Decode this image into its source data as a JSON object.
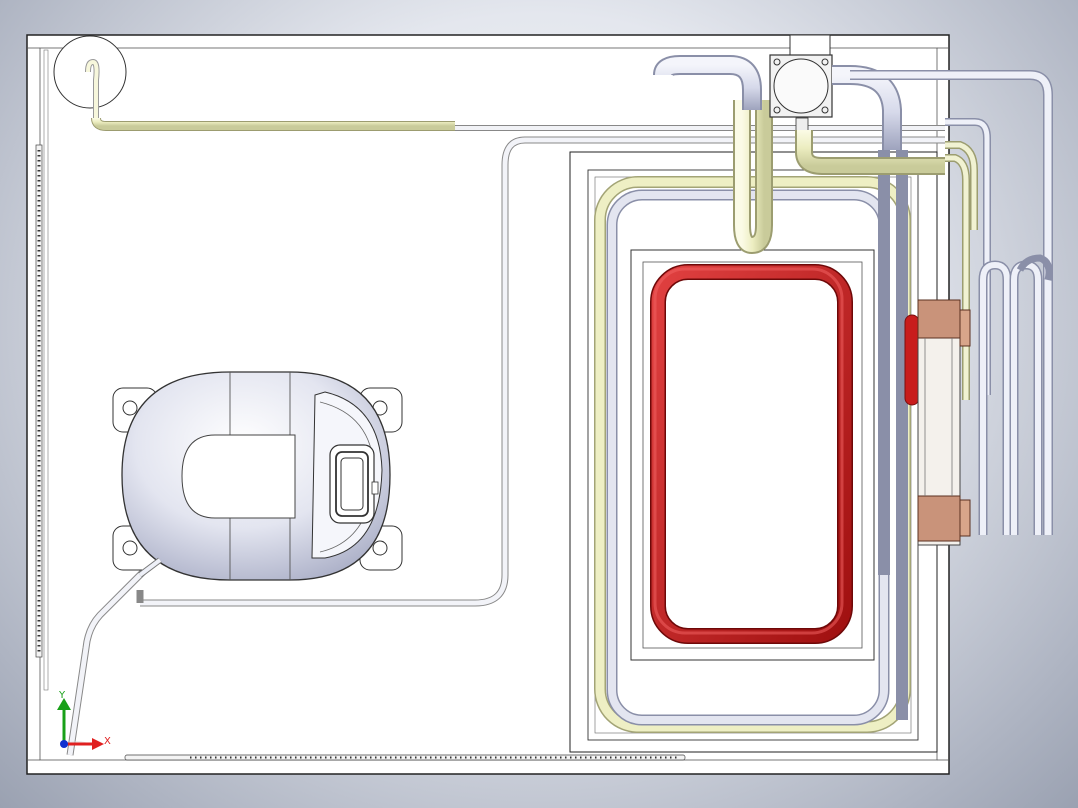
{
  "viewport": {
    "background": "#cfd3dc",
    "triad": {
      "x_label": "X",
      "y_label": "Y",
      "x_color": "#e02020",
      "y_color": "#18a018",
      "origin_color": "#1030d0"
    }
  },
  "model": {
    "panel_color": "#ffffff",
    "edge_color": "#2a2a2a",
    "tube_color": "#f2f3c8",
    "tube_shade": "#c8c9a0",
    "chrome_color": "#d9dcea",
    "heater_color": "#c41a1a",
    "connector_color": "#b07050",
    "components": [
      {
        "name": "compressor",
        "icon": "compressor-icon"
      },
      {
        "name": "heater-loop",
        "icon": "heater-loop-icon"
      },
      {
        "name": "junction-box",
        "icon": "junction-box-icon"
      },
      {
        "name": "fan-motor",
        "icon": "fan-motor-icon"
      },
      {
        "name": "condenser-coil",
        "icon": "condenser-coil-icon"
      }
    ]
  }
}
